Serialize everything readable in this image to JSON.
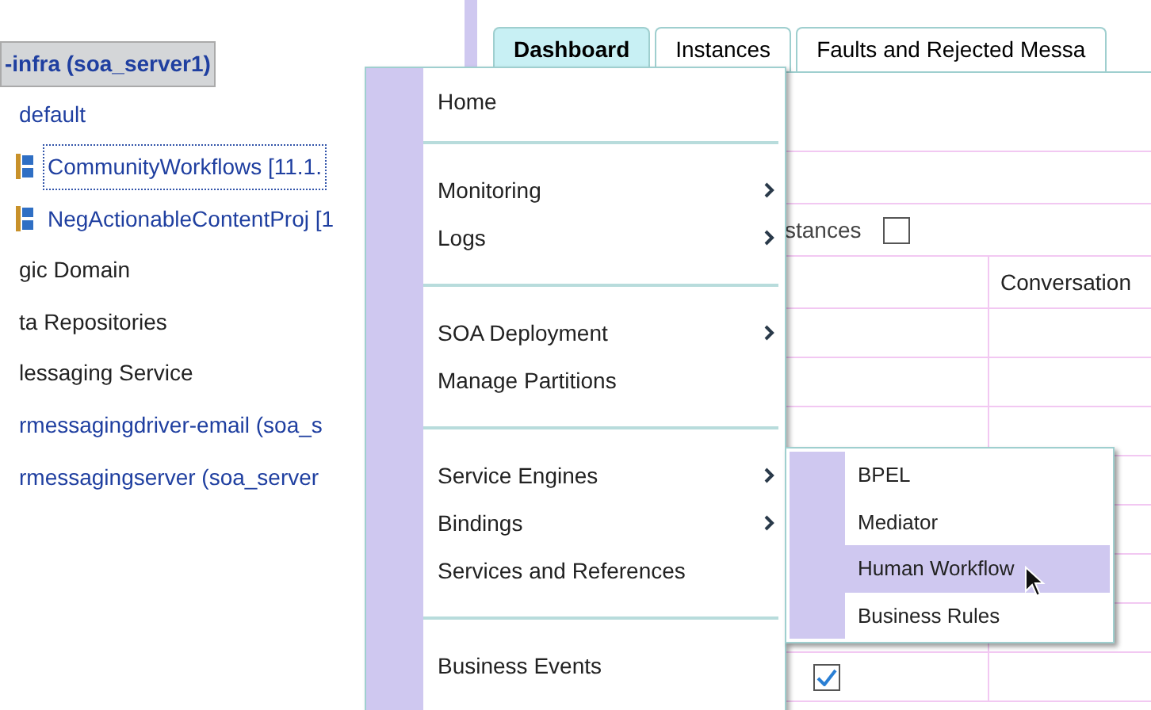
{
  "tree": {
    "items": [
      {
        "label": "-infra (soa_server1)",
        "kind": "server",
        "selected": true
      },
      {
        "label": "default",
        "kind": "link",
        "selected": false
      },
      {
        "label": "CommunityWorkflows [11.1.",
        "kind": "composite",
        "selected": false
      },
      {
        "label": "NegActionableContentProj [1",
        "kind": "composite",
        "selected": false
      },
      {
        "label": "gic Domain",
        "kind": "folder",
        "selected": false
      },
      {
        "label": "ta Repositories",
        "kind": "folder",
        "selected": false
      },
      {
        "label": "lessaging Service",
        "kind": "folder",
        "selected": false
      },
      {
        "label": "rmessagingdriver-email (soa_s",
        "kind": "link",
        "selected": false
      },
      {
        "label": "rmessagingserver (soa_server",
        "kind": "link",
        "selected": false
      }
    ]
  },
  "tabs": [
    {
      "label": "Dashboard",
      "selected": true
    },
    {
      "label": "Instances",
      "selected": false
    },
    {
      "label": "Faults and Rejected Messa",
      "selected": false
    }
  ],
  "content": {
    "option_label": "stances",
    "option_checked": false,
    "table_column": "Conversation",
    "row_checked": true
  },
  "context_menu": {
    "groups": [
      [
        {
          "label": "Home",
          "has_submenu": false
        }
      ],
      [
        {
          "label": "Monitoring",
          "has_submenu": true
        },
        {
          "label": "Logs",
          "has_submenu": true
        }
      ],
      [
        {
          "label": "SOA Deployment",
          "has_submenu": true
        },
        {
          "label": "Manage Partitions",
          "has_submenu": false
        }
      ],
      [
        {
          "label": "Service Engines",
          "has_submenu": true
        },
        {
          "label": "Bindings",
          "has_submenu": true
        },
        {
          "label": "Services and References",
          "has_submenu": false
        }
      ],
      [
        {
          "label": "Business Events",
          "has_submenu": false
        }
      ]
    ]
  },
  "submenu": {
    "items": [
      {
        "label": "BPEL",
        "selected": false
      },
      {
        "label": "Mediator",
        "selected": false
      },
      {
        "label": "Human Workflow",
        "selected": true
      },
      {
        "label": "Business Rules",
        "selected": false
      }
    ]
  }
}
